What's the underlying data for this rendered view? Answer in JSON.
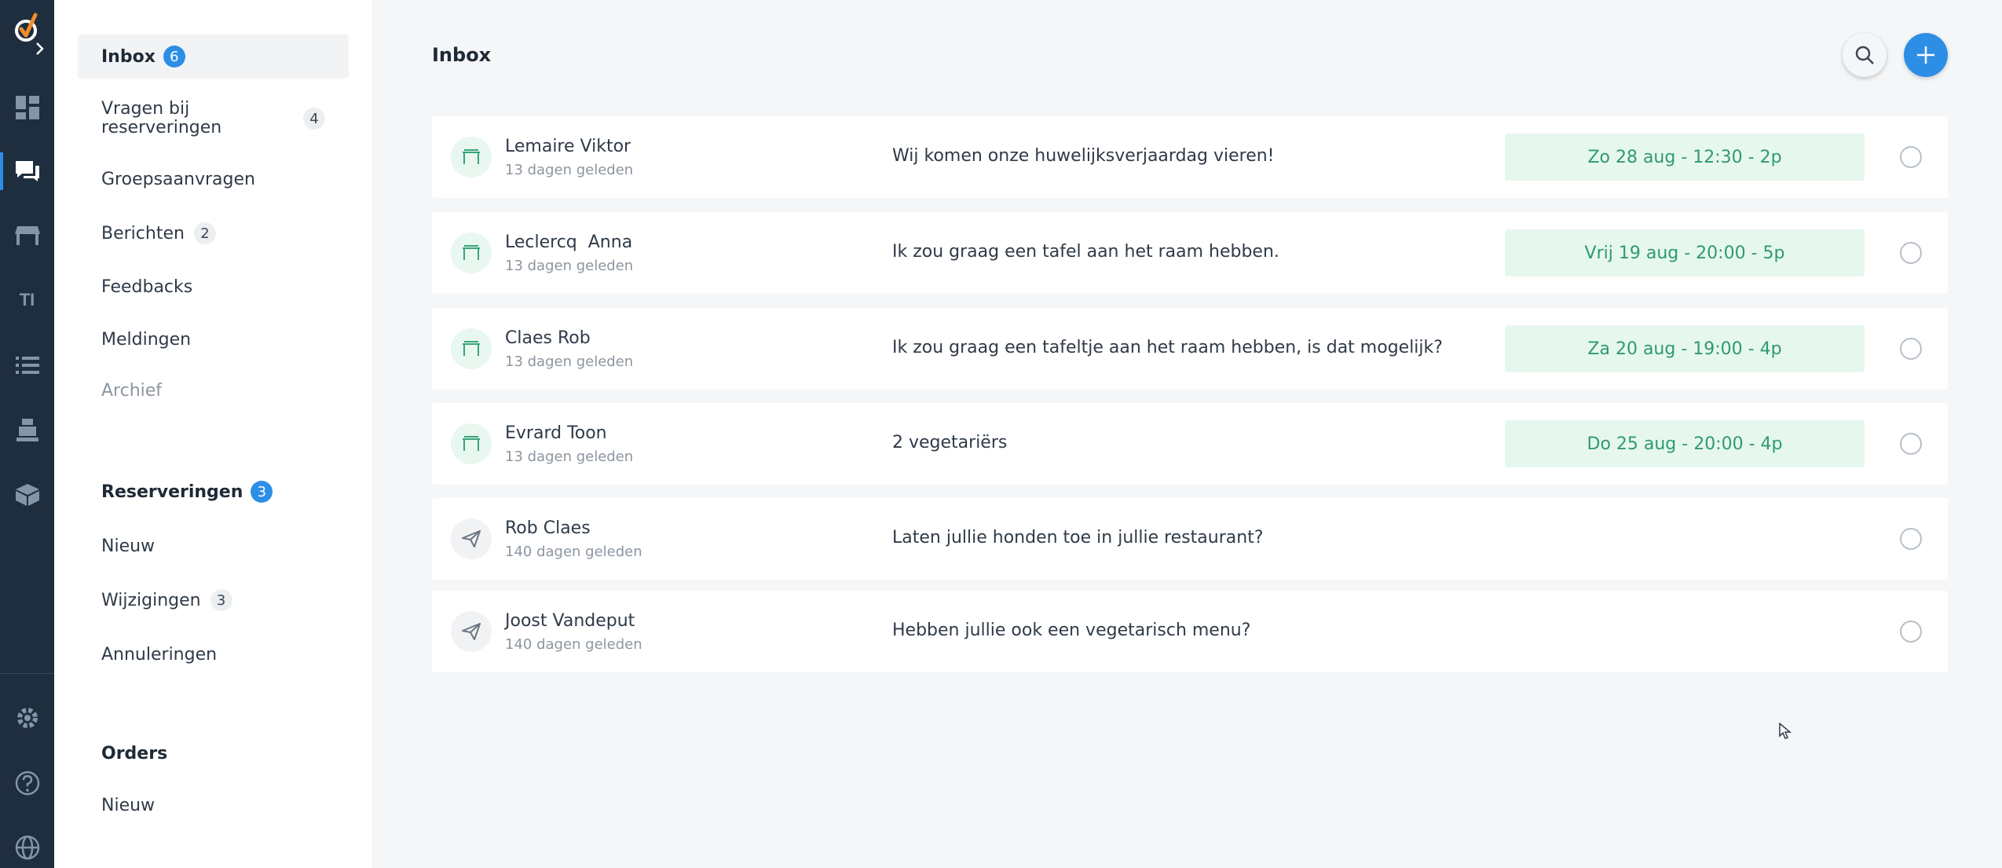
{
  "colors": {
    "rail_bg": "#1f2e3e",
    "accent": "#2d8ee6",
    "pill_bg": "#e6f7ee",
    "pill_text": "#2f9a6e"
  },
  "rail": {
    "icons": [
      "logo-icon",
      "chevron-right-icon",
      "dashboard-icon",
      "chat-icon",
      "table-icon",
      "text-icon",
      "list-icon",
      "register-icon",
      "box-icon",
      "gear-icon",
      "help-icon",
      "globe-icon"
    ],
    "text_icon_label": "TI"
  },
  "sidenav": {
    "inbox": {
      "label": "Inbox",
      "count": "6"
    },
    "questions": {
      "label": "Vragen bij reserveringen",
      "count": "4"
    },
    "groups": {
      "label": "Groepsaanvragen"
    },
    "messages": {
      "label": "Berichten",
      "count": "2"
    },
    "feedbacks": {
      "label": "Feedbacks"
    },
    "notifications": {
      "label": "Meldingen"
    },
    "archive": {
      "label": "Archief"
    },
    "reservations": {
      "label": "Reserveringen",
      "count": "3"
    },
    "res_new": {
      "label": "Nieuw"
    },
    "res_changes": {
      "label": "Wijzigingen",
      "count": "3"
    },
    "res_cancel": {
      "label": "Annuleringen"
    },
    "orders": {
      "label": "Orders"
    },
    "orders_new": {
      "label": "Nieuw"
    }
  },
  "main": {
    "title": "Inbox",
    "rows": [
      {
        "name": "Lemaire Viktor",
        "time": "13 dagen geleden",
        "message": "Wij komen onze huwelijksverjaardag vieren!",
        "reservation": "Zo 28 aug - 12:30 - 2p",
        "type": "reservation"
      },
      {
        "name": "Leclercq  Anna",
        "time": "13 dagen geleden",
        "message": "Ik zou graag een tafel aan het raam hebben.",
        "reservation": "Vrij 19 aug - 20:00 - 5p",
        "type": "reservation"
      },
      {
        "name": "Claes Rob",
        "time": "13 dagen geleden",
        "message": "Ik zou graag een tafeltje aan het raam hebben, is dat mogelijk?",
        "reservation": "Za 20 aug - 19:00 - 4p",
        "type": "reservation"
      },
      {
        "name": "Evrard Toon",
        "time": "13 dagen geleden",
        "message": "2 vegetariërs",
        "reservation": "Do 25 aug - 20:00 - 4p",
        "type": "reservation"
      },
      {
        "name": "Rob Claes",
        "time": "140 dagen geleden",
        "message": "Laten jullie honden toe in jullie restaurant?",
        "type": "message"
      },
      {
        "name": "Joost Vandeput",
        "time": "140 dagen geleden",
        "message": "Hebben jullie ook een vegetarisch menu?",
        "type": "message"
      }
    ]
  }
}
